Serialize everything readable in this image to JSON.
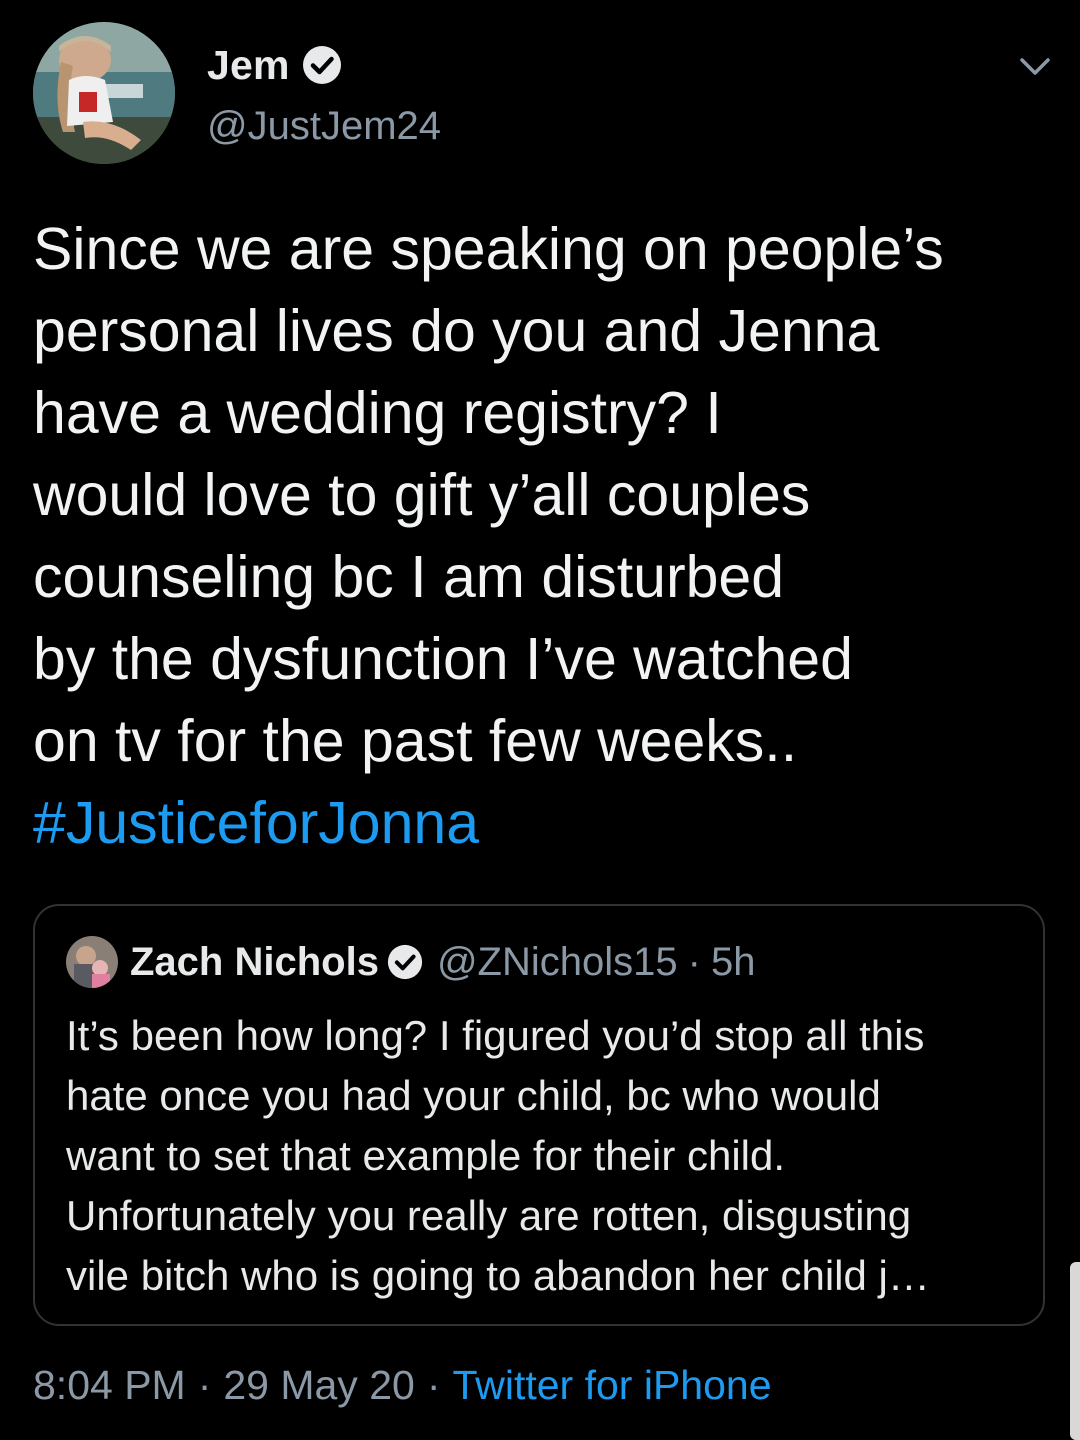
{
  "tweet": {
    "author": {
      "display_name": "Jem",
      "handle": "@JustJem24",
      "verified": true,
      "avatar_icon": "profile-photo"
    },
    "menu_icon": "chevron-down-icon",
    "text_lines": [
      "Since we are speaking on people’s",
      "personal lives do you and Jenna",
      "have a wedding registry? I",
      "would love to gift y’all couples",
      "counseling bc I am disturbed",
      "by the dysfunction I’ve watched",
      "on tv for the past few weeks.."
    ],
    "hashtag": "#JusticeforJonna",
    "quoted": {
      "display_name": "Zach Nichols",
      "handle": "@ZNichols15",
      "separator": "·",
      "time": "5h",
      "verified": true,
      "text_lines": [
        "It’s been how long? I figured you’d stop all this",
        "hate once you had your child, bc who would",
        "want to set that example for their child.",
        "Unfortunately you really are rotten, disgusting",
        "vile bitch who is going to abandon her child j…"
      ]
    },
    "meta": {
      "time": "8:04 PM",
      "separator": "·",
      "date": "29 May 20",
      "source": "Twitter for iPhone"
    }
  },
  "colors": {
    "background": "#000000",
    "accent": "#1d9bf0",
    "secondary_text": "#8b98a5",
    "border": "#2f3336"
  }
}
